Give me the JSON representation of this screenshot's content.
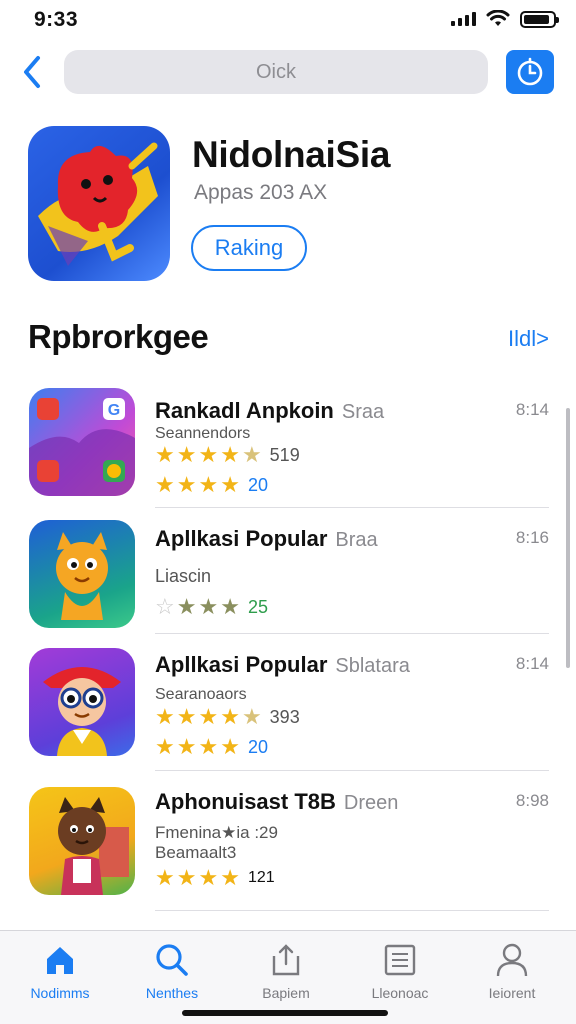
{
  "status_bar": {
    "time": "9:33",
    "battery_level": 0.9
  },
  "nav": {
    "search_placeholder": "Oick",
    "back_icon": "chevron-left-icon",
    "right_icon": "timer-icon"
  },
  "hero": {
    "title": "NidolnaiSia",
    "subtitle": "Appas 203 AX",
    "button": "Raking"
  },
  "section": {
    "title": "Rpbrorkgee",
    "link": "Ildl>"
  },
  "list": [
    {
      "name": "Rankadl Anpkoin",
      "tag": "Sraa",
      "meta": "8:14",
      "line1": "Seannendors",
      "rating_a": 4.5,
      "count_a": "519",
      "rating_b": 4,
      "count_b": "20"
    },
    {
      "name": "Apllkasi Popular",
      "tag": "Braa",
      "meta": "8:16",
      "line1": "Liascin",
      "rating_a": 3,
      "count_a": "25"
    },
    {
      "name": "Apllkasi Popular",
      "tag": "Sblatara",
      "meta": "8:14",
      "line1": "Searanoaors",
      "rating_a": 4.5,
      "count_a": "393",
      "rating_b": 4,
      "count_b": "20"
    },
    {
      "name": "Aphonuisast T8B",
      "tag": "Dreen",
      "meta": "8:98",
      "line1": "Fmenina★ia :29",
      "line2": "Beamaalt3",
      "rating_a": 4,
      "count_a": "121"
    }
  ],
  "tabs": [
    {
      "label": "Nodimms",
      "icon": "home-icon",
      "active": true
    },
    {
      "label": "Nenthes",
      "icon": "search-icon",
      "active": false
    },
    {
      "label": "Bapiem",
      "icon": "share-icon",
      "active": false
    },
    {
      "label": "Lleonoac",
      "icon": "document-icon",
      "active": false
    },
    {
      "label": "Ieiorent",
      "icon": "person-icon",
      "active": false
    }
  ],
  "colors": {
    "accent": "#1b7df2",
    "star": "#f2b417",
    "star_empty": "#c9c9c9",
    "count_blue": "#1b7df2",
    "count_green": "#2e9d4c"
  }
}
